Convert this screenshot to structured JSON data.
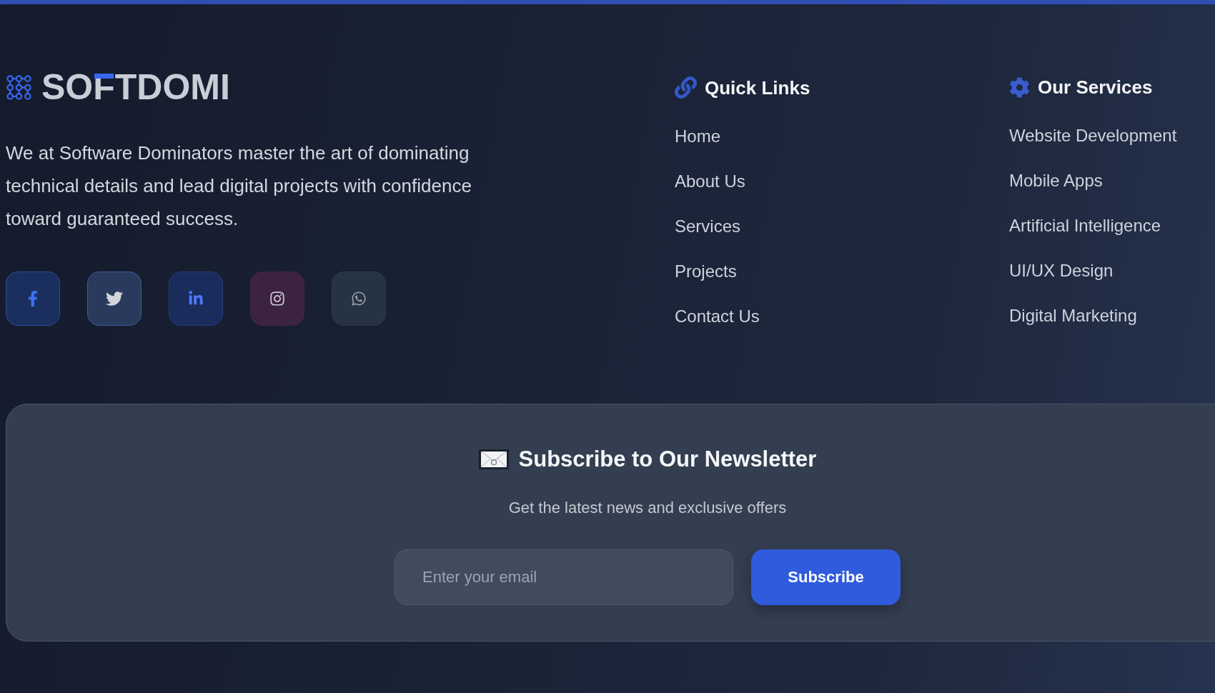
{
  "brand": {
    "name": "SOFTDOMI",
    "description": "We at Software Dominators master the art of dominating technical details and lead digital projects with confidence toward guaranteed success."
  },
  "social_links": [
    {
      "kind": "facebook"
    },
    {
      "kind": "twitter"
    },
    {
      "kind": "linkedin"
    },
    {
      "kind": "instagram"
    },
    {
      "kind": "whatsapp"
    }
  ],
  "quick_links": {
    "title": "Quick Links",
    "items": [
      "Home",
      "About Us",
      "Services",
      "Projects",
      "Contact Us"
    ]
  },
  "services": {
    "title": "Our Services",
    "items": [
      "Website Development",
      "Mobile Apps",
      "Artificial Intelligence",
      "UI/UX Design",
      "Digital Marketing"
    ]
  },
  "newsletter": {
    "title": "Subscribe to Our Newsletter",
    "subtitle": "Get the latest news and exclusive offers",
    "email_field": {
      "placeholder": "Enter your email"
    },
    "button": "Subscribe"
  }
}
